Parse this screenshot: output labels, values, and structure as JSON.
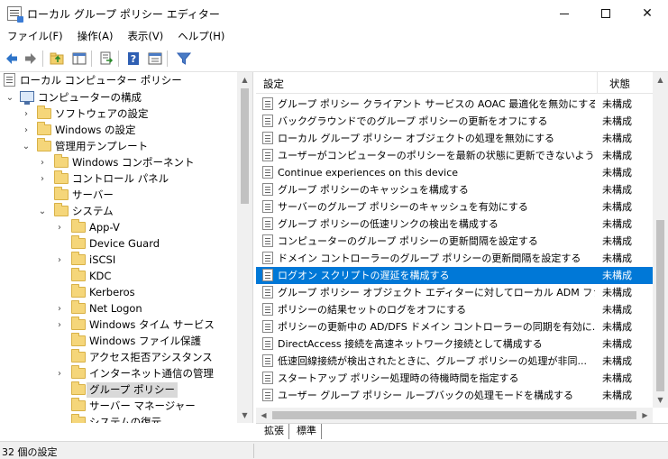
{
  "window": {
    "title": "ローカル グループ ポリシー エディター",
    "minimize_glyph": "",
    "close_glyph": "✕"
  },
  "menu": [
    {
      "label": "ファイル(F)"
    },
    {
      "label": "操作(A)"
    },
    {
      "label": "表示(V)"
    },
    {
      "label": "ヘルプ(H)"
    }
  ],
  "toolbar": {
    "icons": [
      "back-arrow-icon",
      "forward-arrow-icon",
      "up-folder-icon",
      "show-hide-tree-icon",
      "export-list-icon",
      "help-icon",
      "properties-icon",
      "filter-icon"
    ]
  },
  "tree": {
    "root": "ローカル コンピューター ポリシー",
    "computer_config": "コンピューターの構成",
    "software_settings": "ソフトウェアの設定",
    "windows_settings": "Windows の設定",
    "admin_templates": "管理用テンプレート",
    "windows_components": "Windows コンポーネント",
    "control_panel": "コントロール パネル",
    "server": "サーバー",
    "system": "システム",
    "system_children": [
      {
        "label": "App-V",
        "expandable": true
      },
      {
        "label": "Device Guard",
        "expandable": false
      },
      {
        "label": "iSCSI",
        "expandable": true
      },
      {
        "label": "KDC",
        "expandable": false
      },
      {
        "label": "Kerberos",
        "expandable": false
      },
      {
        "label": "Net Logon",
        "expandable": true
      },
      {
        "label": "Windows タイム サービス",
        "expandable": true
      },
      {
        "label": "Windows ファイル保護",
        "expandable": false
      },
      {
        "label": "アクセス拒否アシスタンス",
        "expandable": false
      },
      {
        "label": "インターネット通信の管理",
        "expandable": true
      },
      {
        "label": "グループ ポリシー",
        "expandable": false,
        "selected": true
      },
      {
        "label": "サーバー マネージャー",
        "expandable": false
      },
      {
        "label": "システムの復元",
        "expandable": false
      }
    ]
  },
  "list": {
    "header_setting": "設定",
    "header_state": "状態",
    "rows": [
      {
        "name": "グループ ポリシー クライアント サービスの AOAC 最適化を無効にする",
        "state": "未構成"
      },
      {
        "name": "バックグラウンドでのグループ ポリシーの更新をオフにする",
        "state": "未構成"
      },
      {
        "name": "ローカル グループ ポリシー オブジェクトの処理を無効にする",
        "state": "未構成"
      },
      {
        "name": "ユーザーがコンピューターのポリシーを最新の状態に更新できないように...",
        "state": "未構成"
      },
      {
        "name": "Continue experiences on this device",
        "state": "未構成"
      },
      {
        "name": "グループ ポリシーのキャッシュを構成する",
        "state": "未構成"
      },
      {
        "name": "サーバーのグループ ポリシーのキャッシュを有効にする",
        "state": "未構成"
      },
      {
        "name": "グループ ポリシーの低速リンクの検出を構成する",
        "state": "未構成"
      },
      {
        "name": "コンピューターのグループ ポリシーの更新間隔を設定する",
        "state": "未構成"
      },
      {
        "name": "ドメイン コントローラーのグループ ポリシーの更新間隔を設定する",
        "state": "未構成"
      },
      {
        "name": "ログオン スクリプトの遅延を構成する",
        "state": "未構成",
        "selected": true
      },
      {
        "name": "グループ ポリシー オブジェクト エディターに対してローカル ADM ファイル...",
        "state": "未構成"
      },
      {
        "name": "ポリシーの結果セットのログをオフにする",
        "state": "未構成"
      },
      {
        "name": "ポリシーの更新中の AD/DFS ドメイン コントローラーの同期を有効に...",
        "state": "未構成"
      },
      {
        "name": "DirectAccess 接続を高速ネットワーク接続として構成する",
        "state": "未構成"
      },
      {
        "name": "低速回線接続が検出されたときに、グループ ポリシーの処理が非同...",
        "state": "未構成"
      },
      {
        "name": "スタートアップ ポリシー処理時の待機時間を指定する",
        "state": "未構成"
      },
      {
        "name": "ユーザー グループ ポリシー ループバックの処理モードを構成する",
        "state": "未構成"
      }
    ]
  },
  "tabs": [
    {
      "label": "拡張"
    },
    {
      "label": "標準",
      "active": true
    }
  ],
  "status": {
    "text": "32 個の設定"
  },
  "colors": {
    "selection": "#0078d7",
    "tree_selection": "#d9d9d9"
  }
}
